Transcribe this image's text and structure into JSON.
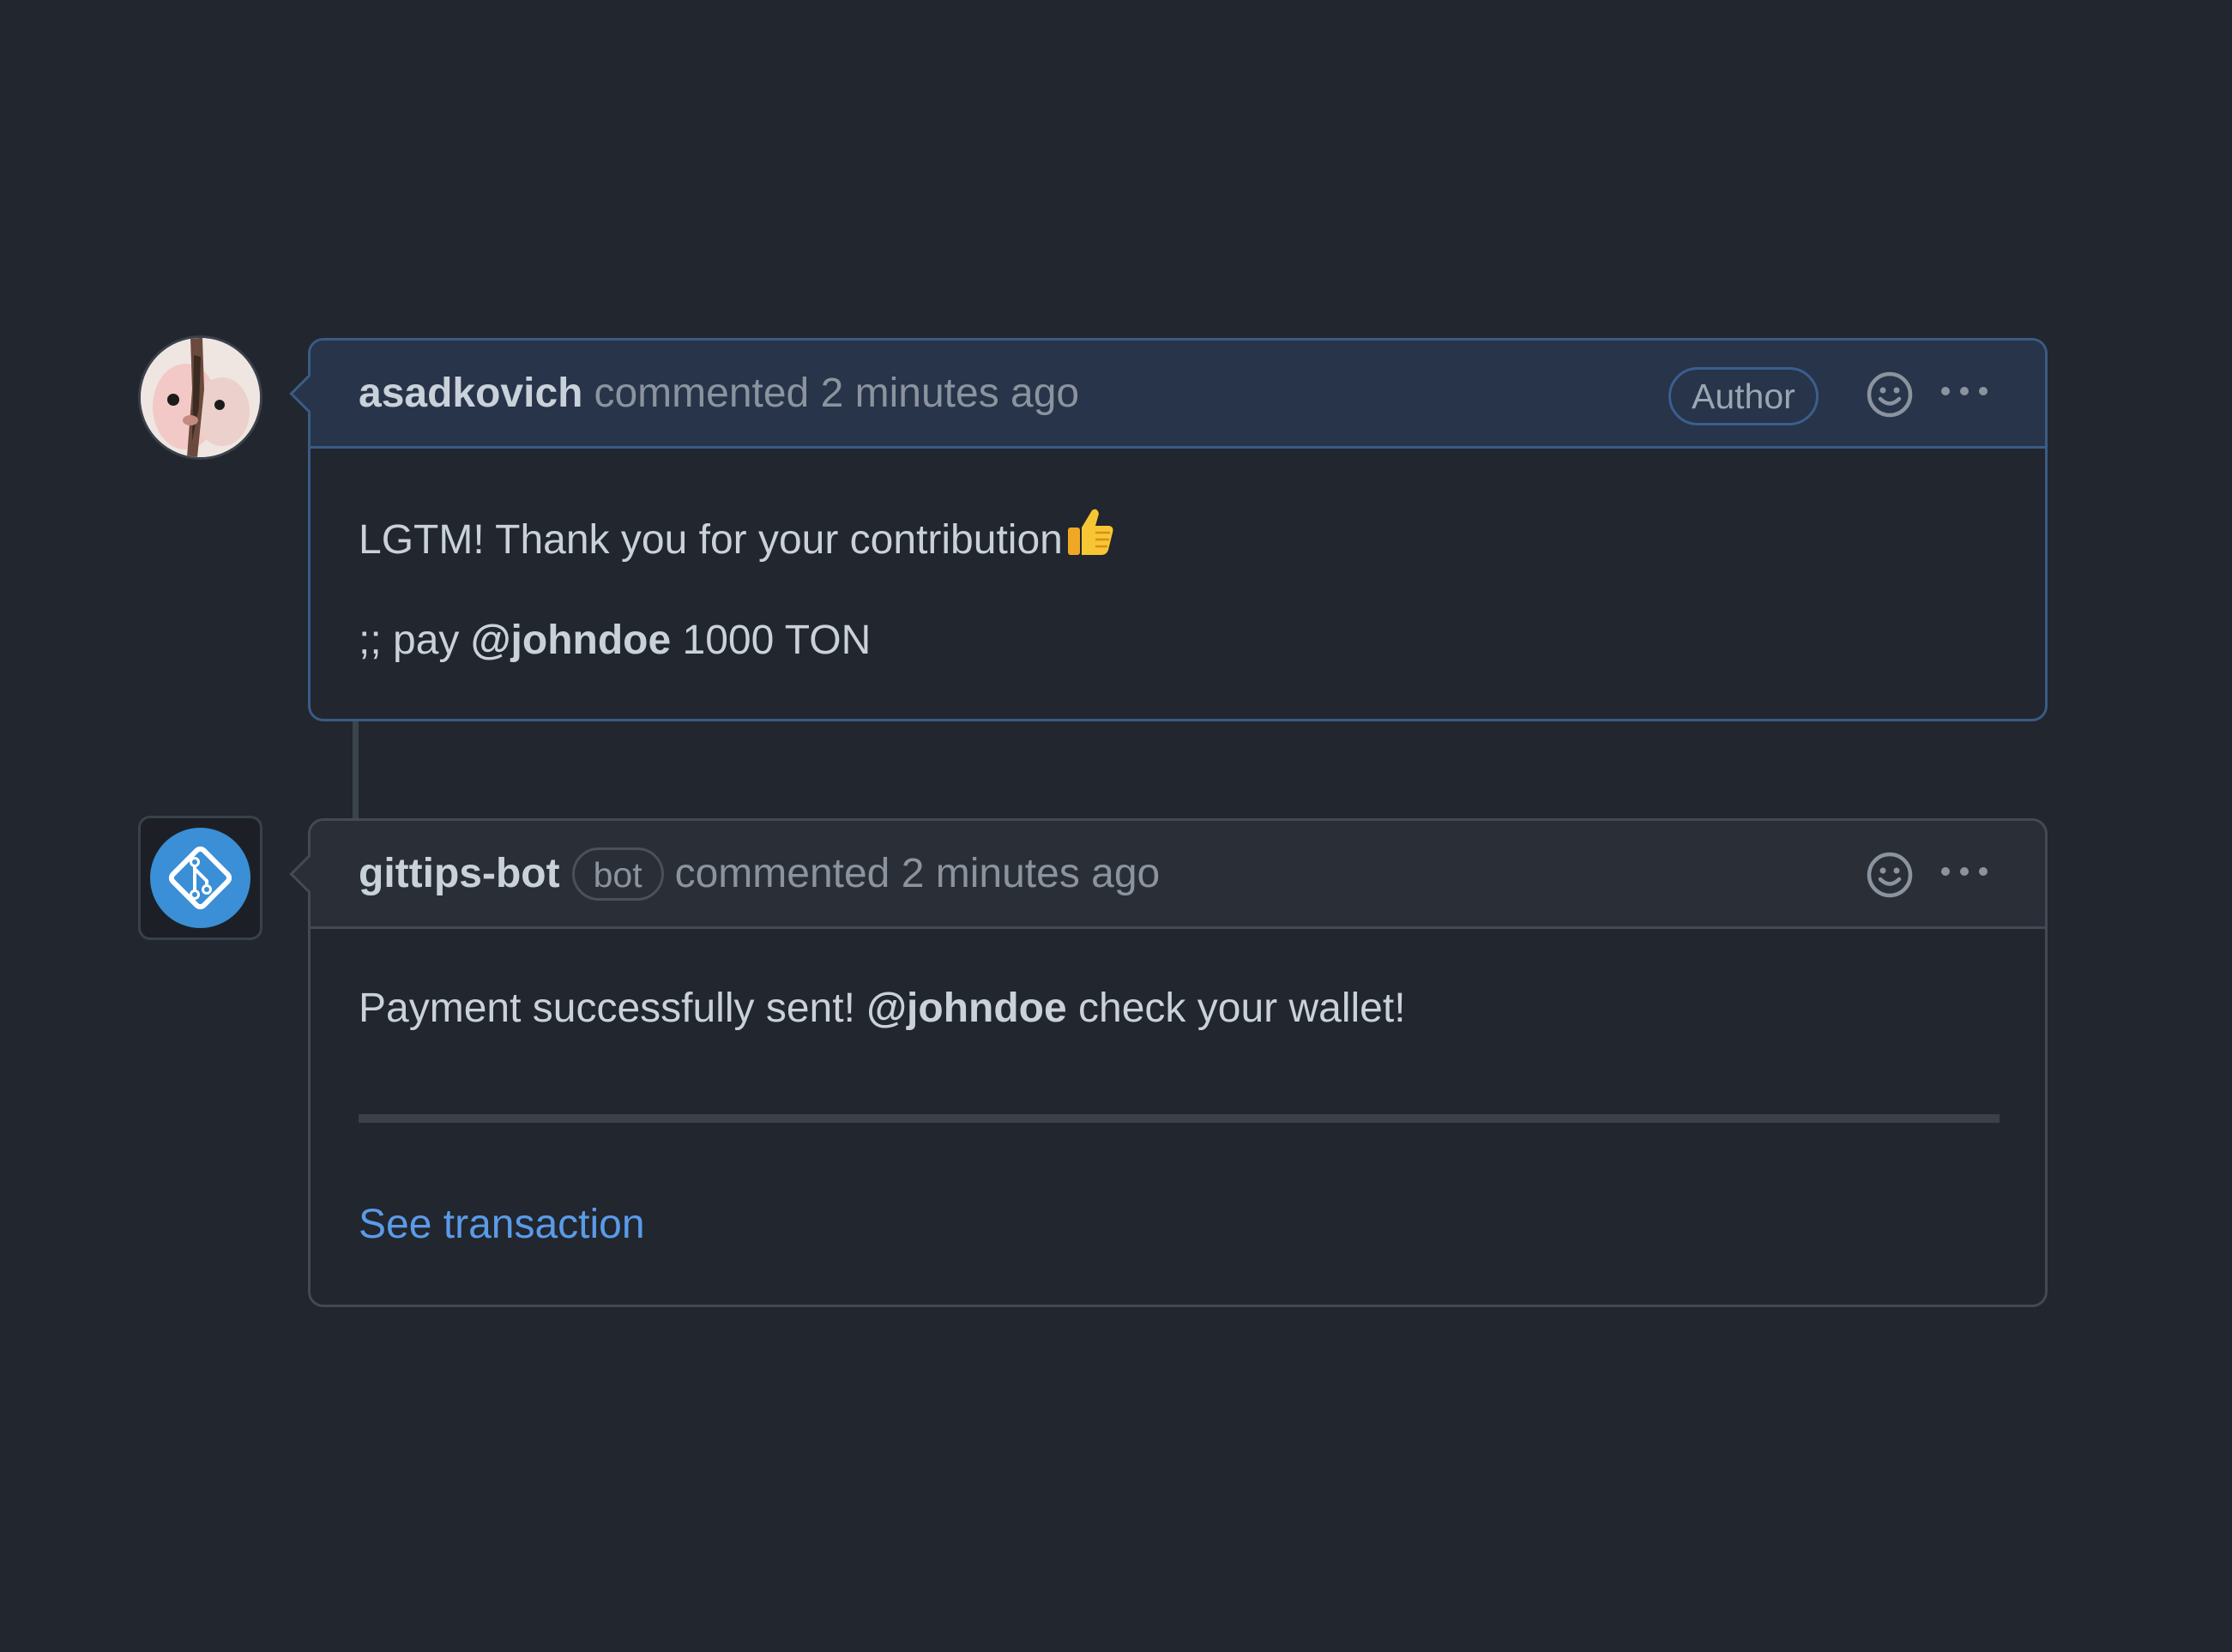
{
  "comments": [
    {
      "username": "asadkovich",
      "meta": "commented 2 minutes ago",
      "badge": "Author",
      "body": {
        "line1": "LGTM! Thank you for your contribution",
        "line1_emoji": "thumbs-up-icon",
        "line2_prefix": ";; pay",
        "line2_mention": "@johndoe",
        "line2_suffix": "1000 TON"
      }
    },
    {
      "username": "gittips-bot",
      "bot_badge": "bot",
      "meta": "commented 2 minutes ago",
      "body": {
        "text_before": "Payment successfully sent!",
        "mention": "@johndoe",
        "text_after": "check your wallet!",
        "link": "See transaction"
      }
    }
  ],
  "icons": {
    "reaction": "smiley-icon",
    "more": "kebab-horizontal-icon",
    "bot_avatar": "git-diamond-icon"
  },
  "colors": {
    "background": "#22262e",
    "author_header": "#27344a",
    "author_border": "#3b5b85",
    "link": "#5a9be9",
    "bot_avatar": "#3a8fd6"
  }
}
